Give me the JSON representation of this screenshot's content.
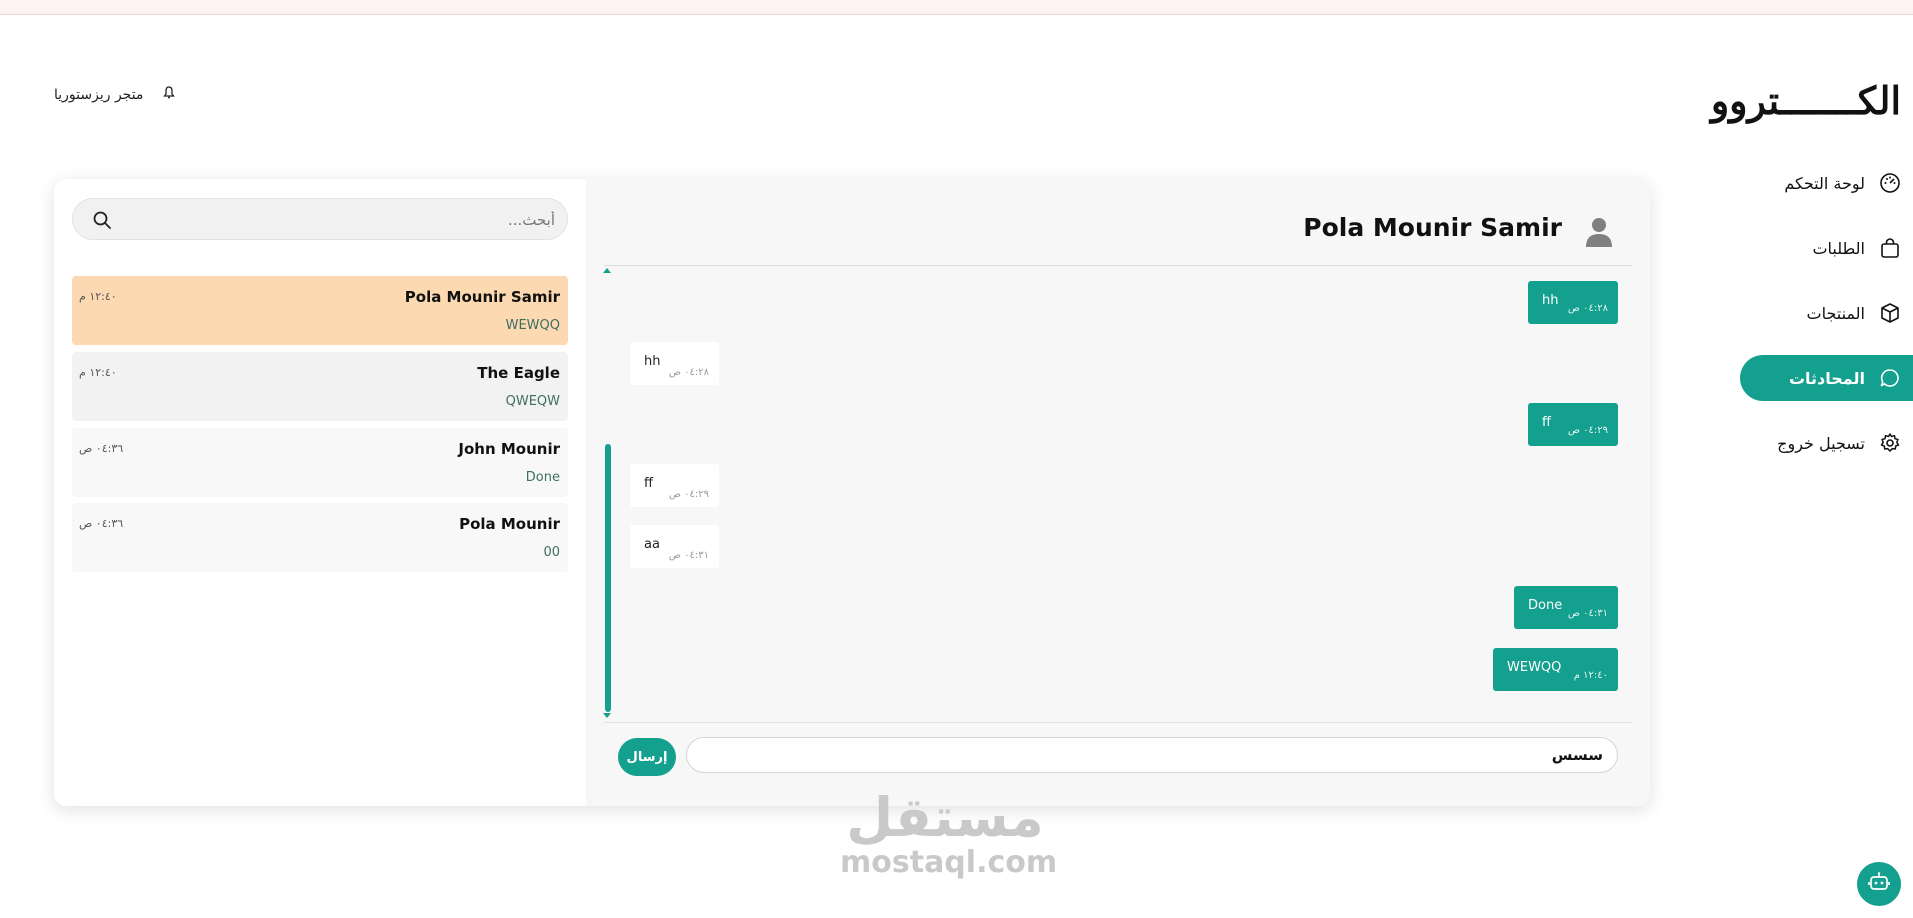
{
  "brand": {
    "logo": "الكـــــــتروو",
    "store_name": "متجر ريزستوريا"
  },
  "sidebar": {
    "items": [
      {
        "label": "لوحة التحكم",
        "icon": "dashboard-icon",
        "active": false
      },
      {
        "label": "الطلبات",
        "icon": "shopping-bag-icon",
        "active": false
      },
      {
        "label": "المنتجات",
        "icon": "box-icon",
        "active": false
      },
      {
        "label": "المحادثات",
        "icon": "chat-bubble-icon",
        "active": true
      },
      {
        "label": "تسجيل خروج",
        "icon": "gear-icon",
        "active": false
      }
    ]
  },
  "chat": {
    "contact_name": "Pola Mounir Samir",
    "messages": [
      {
        "dir": "out",
        "text": "hh",
        "time": "٠٤:٢٨ ص"
      },
      {
        "dir": "in",
        "text": "hh",
        "time": "٠٤:٢٨ ص"
      },
      {
        "dir": "out",
        "text": "ff",
        "time": "٠٤:٢٩ ص"
      },
      {
        "dir": "in",
        "text": "ff",
        "time": "٠٤:٢٩ ص"
      },
      {
        "dir": "in",
        "text": "aa",
        "time": "٠٤:٣١ ص"
      },
      {
        "dir": "out",
        "text": "Done",
        "time": "٠٤:٣١ ص"
      },
      {
        "dir": "out",
        "text": "WEWQQ",
        "time": "١٢:٤٠ م"
      }
    ],
    "input_value": "سسس",
    "send_label": "إرسال"
  },
  "conversations": {
    "search_placeholder": "أبحث...",
    "items": [
      {
        "name": "Pola Mounir Samir",
        "preview": "WEWQQ",
        "time": "١٢:٤٠ م",
        "active": true
      },
      {
        "name": "The Eagle",
        "preview": "QWEQW",
        "time": "١٢:٤٠ م",
        "active": false
      },
      {
        "name": "John Mounir",
        "preview": "Done",
        "time": "٠٤:٣٦ ص",
        "active": false
      },
      {
        "name": "Pola Mounir",
        "preview": "00",
        "time": "٠٤:٣٦ ص",
        "active": false
      }
    ]
  },
  "watermark": {
    "arabic": "مستقل",
    "latin": "mostaql.com"
  },
  "colors": {
    "accent": "#14a08e",
    "active_conversation": "#fcd9b1"
  }
}
